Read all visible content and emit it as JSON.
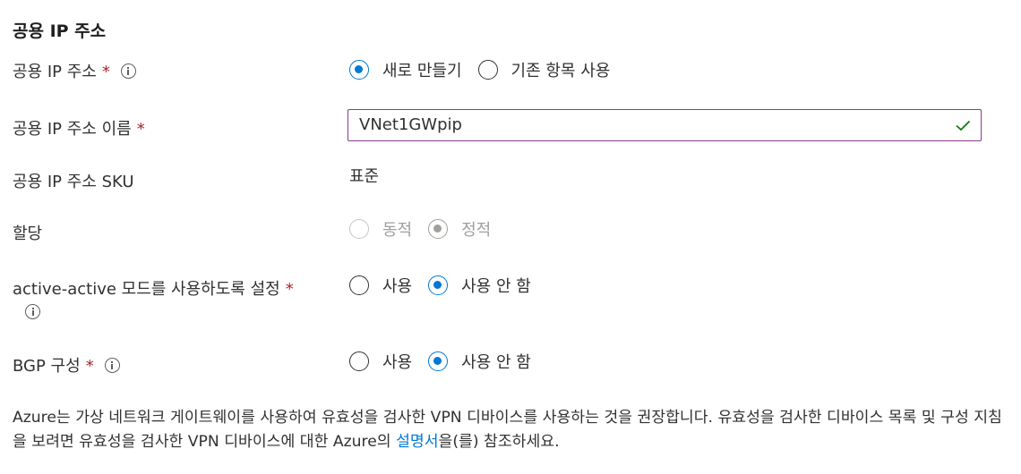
{
  "section_title": "공용 IP 주소",
  "rows": {
    "public_ip": {
      "label": "공용 IP 주소",
      "required_mark": "*",
      "options": [
        "새로 만들기",
        "기존 항목 사용"
      ],
      "selected": "새로 만들기"
    },
    "public_ip_name": {
      "label": "공용 IP 주소 이름",
      "required_mark": "*",
      "value": "VNet1GWpip",
      "valid": true
    },
    "public_ip_sku": {
      "label": "공용 IP 주소 SKU",
      "value": "표준"
    },
    "assignment": {
      "label": "할당",
      "options": [
        "동적",
        "정적"
      ],
      "selected": "정적",
      "disabled": true
    },
    "active_active": {
      "label": "active-active 모드를 사용하도록 설정",
      "required_mark": "*",
      "options": [
        "사용",
        "사용 안 함"
      ],
      "selected": "사용 안 함"
    },
    "bgp": {
      "label": "BGP 구성",
      "required_mark": "*",
      "options": [
        "사용",
        "사용 안 함"
      ],
      "selected": "사용 안 함"
    }
  },
  "description": {
    "text_before_link": "Azure는 가상 네트워크 게이트웨이를 사용하여 유효성을 검사한 VPN 디바이스를 사용하는 것을 권장합니다. 유효성을 검사한 디바이스 목록 및 구성 지침을 보려면 유효성을 검사한 VPN 디바이스에 대한 Azure의 ",
    "link_text": "설명서",
    "text_after_link": "을(를) 참조하세요."
  },
  "colors": {
    "accent": "#0078d4",
    "required": "#a4262c",
    "valid_check": "#107c10",
    "input_border": "#8a3a8e"
  },
  "icons": {
    "info": "info-icon",
    "valid": "checkmark-icon"
  }
}
